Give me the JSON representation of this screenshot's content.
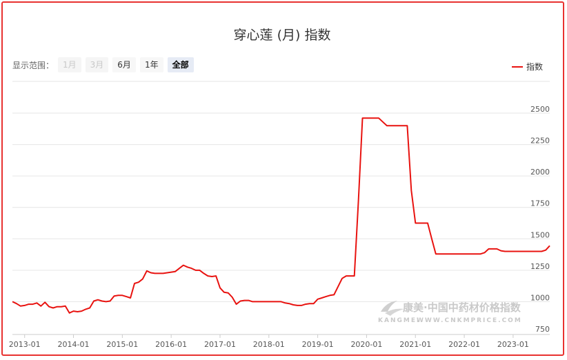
{
  "title": "穿心莲 (月) 指数",
  "range": {
    "label": "显示范围：",
    "buttons": [
      {
        "label": "1月",
        "state": "disabled"
      },
      {
        "label": "3月",
        "state": "disabled"
      },
      {
        "label": "6月",
        "state": "normal"
      },
      {
        "label": "1年",
        "state": "normal"
      },
      {
        "label": "全部",
        "state": "active"
      }
    ]
  },
  "watermark": {
    "brand": "康美·中国中药材价格指数",
    "sub": "KANGMEI",
    "url": "WWW.CNKMPRICE.COM"
  },
  "colors": {
    "series": "#e8120f",
    "frame": "#e8312f",
    "grid": "#e6e6e6"
  },
  "chart_data": {
    "type": "line",
    "title": "穿心莲 (月) 指数",
    "legend": "top-right",
    "grid": true,
    "y_axis_side": "right",
    "ylim": [
      750,
      2500
    ],
    "yticks": [
      750,
      1000,
      1250,
      1500,
      1750,
      2000,
      2250,
      2500
    ],
    "xlim": [
      "2012-10",
      "2023-10"
    ],
    "xticks": [
      "2013-01",
      "2014-01",
      "2015-01",
      "2016-01",
      "2017-01",
      "2018-01",
      "2019-01",
      "2020-01",
      "2021-01",
      "2022-01",
      "2023-01"
    ],
    "series": [
      {
        "name": "指数",
        "points": [
          [
            "2012-10",
            1000
          ],
          [
            "2012-11",
            985
          ],
          [
            "2012-12",
            965
          ],
          [
            "2013-01",
            970
          ],
          [
            "2013-02",
            980
          ],
          [
            "2013-03",
            980
          ],
          [
            "2013-04",
            990
          ],
          [
            "2013-05",
            965
          ],
          [
            "2013-06",
            995
          ],
          [
            "2013-07",
            960
          ],
          [
            "2013-08",
            950
          ],
          [
            "2013-09",
            960
          ],
          [
            "2013-10",
            960
          ],
          [
            "2013-11",
            965
          ],
          [
            "2013-12",
            910
          ],
          [
            "2014-01",
            925
          ],
          [
            "2014-02",
            920
          ],
          [
            "2014-03",
            925
          ],
          [
            "2014-04",
            940
          ],
          [
            "2014-05",
            950
          ],
          [
            "2014-06",
            1005
          ],
          [
            "2014-07",
            1015
          ],
          [
            "2014-08",
            1005
          ],
          [
            "2014-09",
            1000
          ],
          [
            "2014-10",
            1005
          ],
          [
            "2014-11",
            1045
          ],
          [
            "2014-12",
            1050
          ],
          [
            "2015-01",
            1050
          ],
          [
            "2015-02",
            1040
          ],
          [
            "2015-03",
            1030
          ],
          [
            "2015-04",
            1145
          ],
          [
            "2015-05",
            1155
          ],
          [
            "2015-06",
            1180
          ],
          [
            "2015-07",
            1245
          ],
          [
            "2015-08",
            1230
          ],
          [
            "2015-09",
            1225
          ],
          [
            "2015-10",
            1225
          ],
          [
            "2015-11",
            1225
          ],
          [
            "2015-12",
            1230
          ],
          [
            "2016-01",
            1235
          ],
          [
            "2016-02",
            1240
          ],
          [
            "2016-03",
            1265
          ],
          [
            "2016-04",
            1290
          ],
          [
            "2016-05",
            1275
          ],
          [
            "2016-06",
            1265
          ],
          [
            "2016-07",
            1250
          ],
          [
            "2016-08",
            1250
          ],
          [
            "2016-09",
            1225
          ],
          [
            "2016-10",
            1205
          ],
          [
            "2016-11",
            1200
          ],
          [
            "2016-12",
            1205
          ],
          [
            "2017-01",
            1110
          ],
          [
            "2017-02",
            1075
          ],
          [
            "2017-03",
            1070
          ],
          [
            "2017-04",
            1035
          ],
          [
            "2017-05",
            980
          ],
          [
            "2017-06",
            1005
          ],
          [
            "2017-07",
            1010
          ],
          [
            "2017-08",
            1010
          ],
          [
            "2017-09",
            1000
          ],
          [
            "2017-10",
            1000
          ],
          [
            "2017-11",
            1000
          ],
          [
            "2017-12",
            1000
          ],
          [
            "2018-01",
            1000
          ],
          [
            "2018-02",
            1000
          ],
          [
            "2018-03",
            1000
          ],
          [
            "2018-04",
            1000
          ],
          [
            "2018-05",
            990
          ],
          [
            "2018-06",
            985
          ],
          [
            "2018-07",
            975
          ],
          [
            "2018-08",
            970
          ],
          [
            "2018-09",
            970
          ],
          [
            "2018-10",
            980
          ],
          [
            "2018-11",
            985
          ],
          [
            "2018-12",
            985
          ],
          [
            "2019-01",
            1020
          ],
          [
            "2019-02",
            1030
          ],
          [
            "2019-03",
            1040
          ],
          [
            "2019-04",
            1050
          ],
          [
            "2019-05",
            1055
          ],
          [
            "2019-06",
            1120
          ],
          [
            "2019-07",
            1185
          ],
          [
            "2019-08",
            1205
          ],
          [
            "2019-09",
            1205
          ],
          [
            "2019-10",
            1205
          ],
          [
            "2019-11",
            1800
          ],
          [
            "2019-12",
            2460
          ],
          [
            "2020-01",
            2460
          ],
          [
            "2020-02",
            2460
          ],
          [
            "2020-03",
            2460
          ],
          [
            "2020-04",
            2460
          ],
          [
            "2020-05",
            2430
          ],
          [
            "2020-06",
            2400
          ],
          [
            "2020-07",
            2400
          ],
          [
            "2020-08",
            2400
          ],
          [
            "2020-09",
            2400
          ],
          [
            "2020-10",
            2400
          ],
          [
            "2020-11",
            2400
          ],
          [
            "2020-12",
            1885
          ],
          [
            "2021-01",
            1625
          ],
          [
            "2021-02",
            1625
          ],
          [
            "2021-03",
            1625
          ],
          [
            "2021-04",
            1625
          ],
          [
            "2021-05",
            1500
          ],
          [
            "2021-06",
            1380
          ],
          [
            "2021-07",
            1380
          ],
          [
            "2021-08",
            1380
          ],
          [
            "2021-09",
            1380
          ],
          [
            "2021-10",
            1380
          ],
          [
            "2021-11",
            1380
          ],
          [
            "2021-12",
            1380
          ],
          [
            "2022-01",
            1380
          ],
          [
            "2022-02",
            1380
          ],
          [
            "2022-03",
            1380
          ],
          [
            "2022-04",
            1380
          ],
          [
            "2022-05",
            1380
          ],
          [
            "2022-06",
            1390
          ],
          [
            "2022-07",
            1420
          ],
          [
            "2022-08",
            1420
          ],
          [
            "2022-09",
            1420
          ],
          [
            "2022-10",
            1405
          ],
          [
            "2022-11",
            1400
          ],
          [
            "2022-12",
            1400
          ],
          [
            "2023-01",
            1400
          ],
          [
            "2023-02",
            1400
          ],
          [
            "2023-03",
            1400
          ],
          [
            "2023-04",
            1400
          ],
          [
            "2023-05",
            1400
          ],
          [
            "2023-06",
            1400
          ],
          [
            "2023-07",
            1400
          ],
          [
            "2023-08",
            1400
          ],
          [
            "2023-09",
            1410
          ],
          [
            "2023-10",
            1445
          ]
        ]
      }
    ]
  }
}
